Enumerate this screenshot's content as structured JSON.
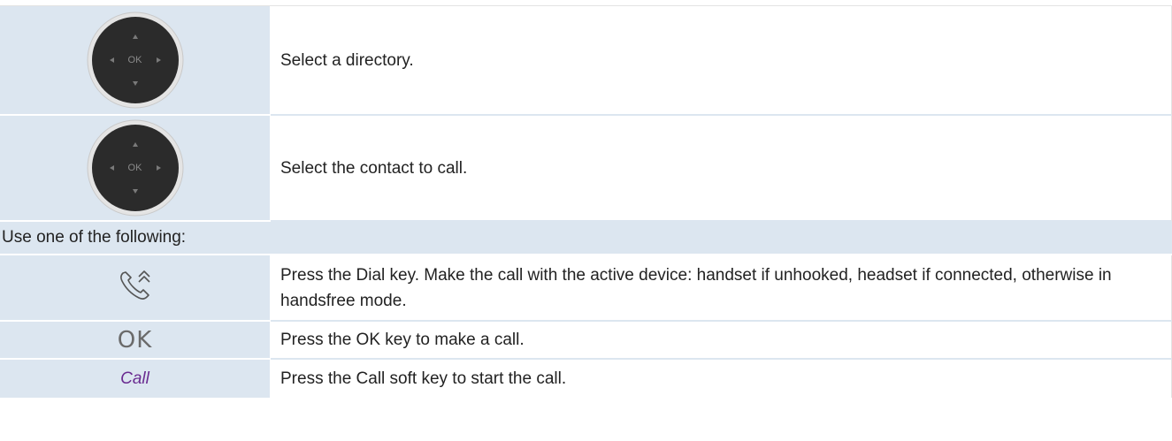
{
  "rows": {
    "nav1": {
      "icon": "navigation-pad-icon",
      "ok_label": "OK",
      "text": "Select a directory."
    },
    "nav2": {
      "icon": "navigation-pad-icon",
      "ok_label": "OK",
      "text": "Select the contact to call."
    },
    "section": {
      "text": "Use one of the following:"
    },
    "dial": {
      "icon": "dial-key-icon",
      "text": "Press the Dial key. Make the call with the active device: handset if unhooked, headset if connected, otherwise in handsfree mode."
    },
    "ok": {
      "key_label": "OK",
      "text": "Press the OK key to make a call."
    },
    "call": {
      "key_label": "Call",
      "text": "Press the Call soft key to start the call."
    }
  },
  "colors": {
    "left_cell_bg": "#dce6f0",
    "soft_key_text": "#6a2c91",
    "navpad_body": "#2b2b2b",
    "navpad_ring": "#e4e4e4"
  }
}
